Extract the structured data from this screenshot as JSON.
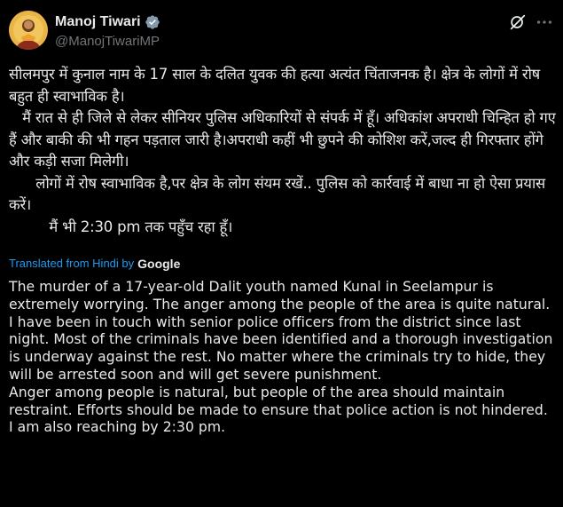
{
  "author": {
    "display_name": "Manoj Tiwari",
    "handle": "@ManojTiwariMP",
    "verified_icon": "verified-badge-icon",
    "avatar_icon": "profile-avatar"
  },
  "actions": {
    "grok_icon": "grok-icon",
    "more_icon": "more-options-icon"
  },
  "colors": {
    "background": "#000000",
    "text": "#e7e9ea",
    "secondary_text": "#71767b",
    "link": "#1d9bf0"
  },
  "original_text": "सीलमपुर में कुनाल नाम के 17 साल के दलित युवक की हत्या अत्यंत चिंताजनक है। क्षेत्र के लोगों में रोष बहुत ही स्वाभाविक है।\n   मैं रात से ही जिले से लेकर सीनियर पुलिस अधिकारियों से संपर्क में हूँ। अधिकांश अपराधी चिन्हित हो गए हैं और बाकी की भी गहन पड़ताल जारी है।अपराधी कहीं भी छुपने की कोशिश करें,जल्द ही गिरफ्तार होंगे और कड़ी सजा मिलेगी।\n      लोगों में रोष स्वाभाविक है,पर क्षेत्र के लोग संयम रखें.. पुलिस को कार्रवाई में बाधा ना हो ऐसा प्रयास करें।\n         मैं भी 2:30 pm तक पहुँच रहा हूँ।",
  "translation": {
    "label": "Translated from Hindi by",
    "provider": "Google",
    "paragraphs": [
      "The murder of a 17-year-old Dalit youth named Kunal in Seelampur is extremely worrying. The anger among the people of the area is quite natural.",
      "I have been in touch with senior police officers from the district since last night. Most of the criminals have been identified and a thorough investigation is underway against the rest. No matter where the criminals try to hide, they will be arrested soon and will get severe punishment.",
      "Anger among people is natural, but people of the area should maintain restraint. Efforts should be made to ensure that police action is not hindered.",
      "I am also reaching by 2:30 pm."
    ]
  }
}
